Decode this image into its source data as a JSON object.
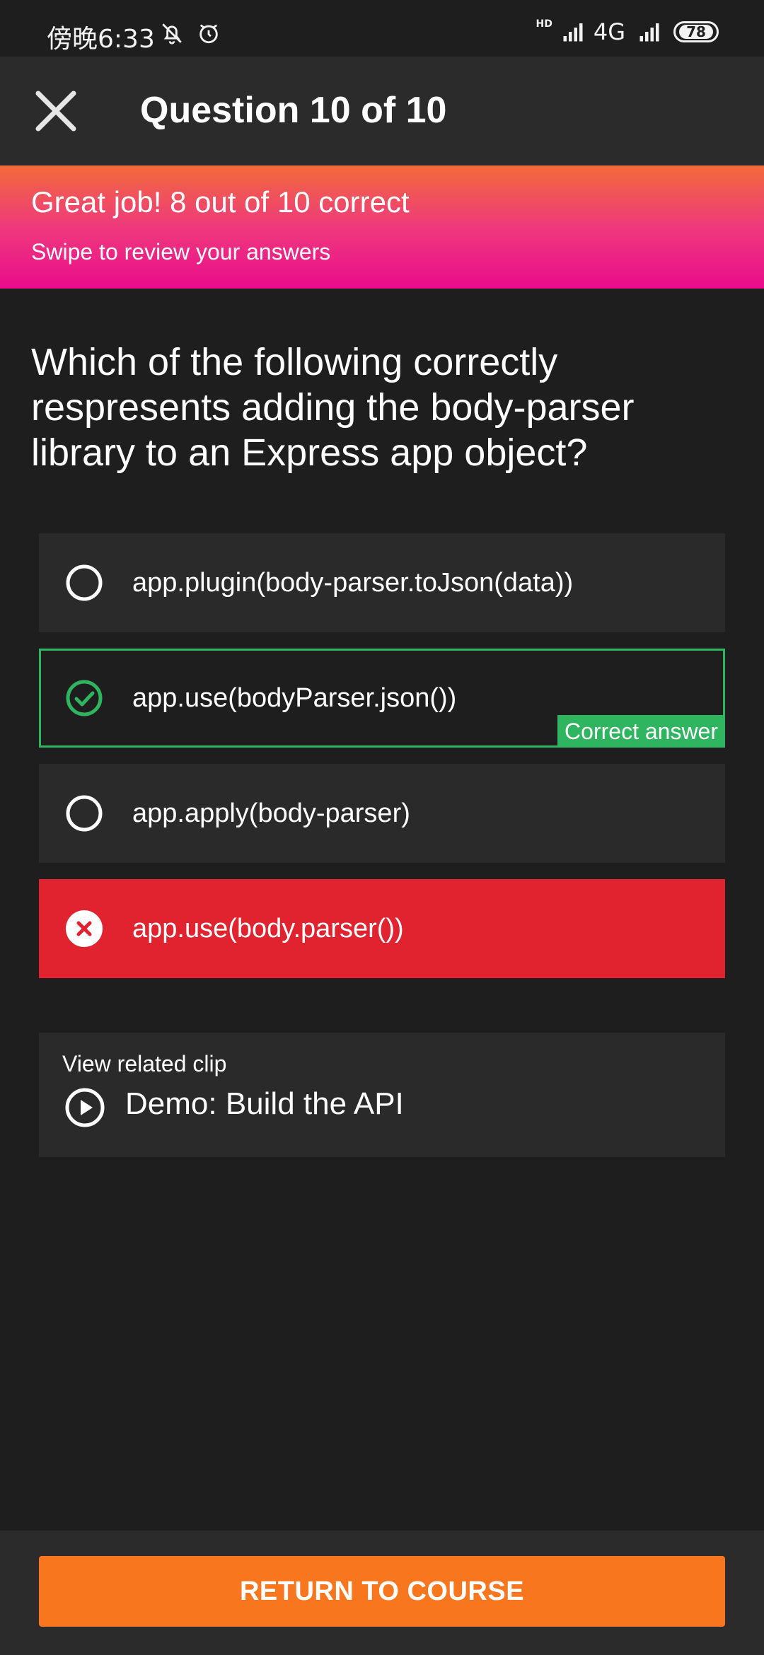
{
  "status_bar": {
    "time": "傍晚6:33",
    "network": "4G",
    "network_badge": "HD",
    "battery": "78",
    "icons": [
      "bell-off-icon",
      "alarm-icon",
      "signal-icon",
      "signal-icon"
    ]
  },
  "header": {
    "title": "Question 10 of 10",
    "close_icon": "close-icon"
  },
  "result_banner": {
    "title": "Great job! 8 out of 10 correct",
    "subtitle": "Swipe to review your answers"
  },
  "question": {
    "text": "Which of the following correctly respresents adding the body-parser library to an Express app object?"
  },
  "options": [
    {
      "text": "app.plugin(body-parser.toJson(data))",
      "state": "unselected"
    },
    {
      "text": "app.use(bodyParser.json())",
      "state": "correct",
      "tag": "Correct answer"
    },
    {
      "text": "app.apply(body-parser)",
      "state": "unselected"
    },
    {
      "text": "app.use(body.parser())",
      "state": "wrong"
    }
  ],
  "related_clip": {
    "label": "View related clip",
    "title": "Demo: Build the API"
  },
  "footer": {
    "button_label": "RETURN TO COURSE"
  },
  "colors": {
    "correct": "#2fb45f",
    "wrong": "#e0232f",
    "accent": "#f7761e",
    "banner_top": "#f26a3a",
    "banner_bottom": "#ea0c8c"
  }
}
